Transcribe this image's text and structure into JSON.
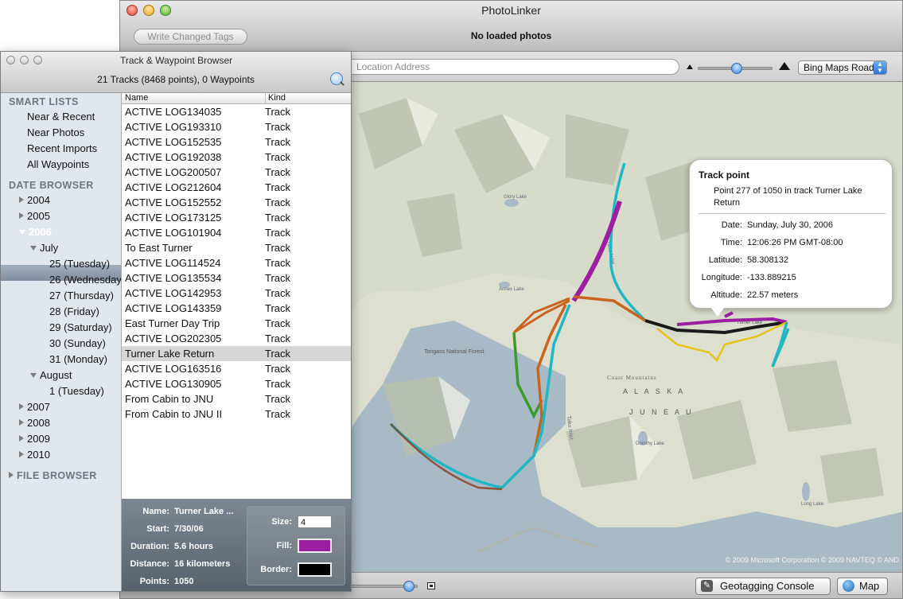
{
  "main_window": {
    "title": "PhotoLinker",
    "write_tags_label": "Write Changed Tags",
    "status": "No loaded photos",
    "address_placeholder": "Location Address",
    "map_type": "Bing Maps Road",
    "copyright": "© 2009 Microsoft Corporation  © 2009 NAVTEQ  © AND",
    "geotagging_console_label": "Geotagging Console",
    "map_label": "Map",
    "map_zoom_level": 0.5,
    "photo_size_level": 0.9
  },
  "browser": {
    "title": "Track & Waypoint Browser",
    "summary": "21 Tracks (8468 points), 0 Waypoints",
    "smart_lists_heading": "SMART LISTS",
    "smart_lists": [
      "Near & Recent",
      "Near Photos",
      "Recent Imports",
      "All Waypoints"
    ],
    "date_browser_heading": "DATE BROWSER",
    "years": [
      "2004",
      "2005",
      "2006",
      "2007",
      "2008",
      "2009",
      "2010"
    ],
    "selected_year": "2006",
    "months": [
      "July",
      "August"
    ],
    "july_days": [
      "25 (Tuesday)",
      "26 (Wednesday)",
      "27 (Thursday)",
      "28 (Friday)",
      "29 (Saturday)",
      "30 (Sunday)",
      "31 (Monday)"
    ],
    "august_days": [
      "1 (Tuesday)"
    ],
    "file_browser_heading": "FILE BROWSER",
    "columns": {
      "name": "Name",
      "kind": "Kind"
    },
    "tracks": [
      {
        "name": "ACTIVE LOG134035",
        "kind": "Track"
      },
      {
        "name": "ACTIVE LOG193310",
        "kind": "Track"
      },
      {
        "name": "ACTIVE LOG152535",
        "kind": "Track"
      },
      {
        "name": "ACTIVE LOG192038",
        "kind": "Track"
      },
      {
        "name": "ACTIVE LOG200507",
        "kind": "Track"
      },
      {
        "name": "ACTIVE LOG212604",
        "kind": "Track"
      },
      {
        "name": "ACTIVE LOG152552",
        "kind": "Track"
      },
      {
        "name": "ACTIVE LOG173125",
        "kind": "Track"
      },
      {
        "name": "ACTIVE LOG101904",
        "kind": "Track"
      },
      {
        "name": "To East Turner",
        "kind": "Track"
      },
      {
        "name": "ACTIVE LOG114524",
        "kind": "Track"
      },
      {
        "name": "ACTIVE LOG135534",
        "kind": "Track"
      },
      {
        "name": "ACTIVE LOG142953",
        "kind": "Track"
      },
      {
        "name": "ACTIVE LOG143359",
        "kind": "Track"
      },
      {
        "name": "East Turner Day Trip",
        "kind": "Track"
      },
      {
        "name": "ACTIVE LOG202305",
        "kind": "Track"
      },
      {
        "name": "Turner Lake Return",
        "kind": "Track"
      },
      {
        "name": "ACTIVE LOG163516",
        "kind": "Track"
      },
      {
        "name": "ACTIVE LOG130905",
        "kind": "Track"
      },
      {
        "name": "From Cabin to JNU",
        "kind": "Track"
      },
      {
        "name": "From Cabin to JNU II",
        "kind": "Track"
      }
    ],
    "selected_track": "Turner Lake Return",
    "details": {
      "name_label": "Name:",
      "name_value": "Turner Lake ...",
      "start_label": "Start:",
      "start_value": "7/30/06",
      "duration_label": "Duration:",
      "duration_value": "5.6 hours",
      "distance_label": "Distance:",
      "distance_value": "16 kilometers",
      "points_label": "Points:",
      "points_value": "1050",
      "size_label": "Size:",
      "size_value": "4",
      "fill_label": "Fill:",
      "fill_color": "#9b1fa0",
      "border_label": "Border:",
      "border_color": "#000000"
    }
  },
  "popover": {
    "title": "Track point",
    "description": "Point 277 of 1050 in track Turner Lake Return",
    "date_label": "Date:",
    "date_value": "Sunday, July 30, 2006",
    "time_label": "Time:",
    "time_value": "12:06:26 PM GMT-08:00",
    "latitude_label": "Latitude:",
    "latitude_value": "58.308132",
    "longitude_label": "Longitude:",
    "longitude_value": "-133.889215",
    "altitude_label": "Altitude:",
    "altitude_value": "22.57 meters"
  },
  "map_labels": {
    "glory_lake": "Glory Lake",
    "annex_lake": "Annex Lake",
    "taku_inlet": "Taku Inlet",
    "tongass": "Tongass National Forest",
    "coast_mountains": "Coast Mountains",
    "alaska": "A L A S K A",
    "juneau": "J U N E A U",
    "dorothy_lake": "Dorothy Lake",
    "long_lake": "Long Lake",
    "turner_lake": "Turner Lake"
  },
  "colors": {
    "water": "#a7bac6",
    "land": "#d9dccc",
    "track_purple": "#9b1fa0",
    "track_cyan": "#1fb7c4",
    "track_orange": "#c8641e",
    "track_yellow": "#e8c21a",
    "track_green": "#3a9a2a",
    "track_dark": "#1a1a1a"
  }
}
